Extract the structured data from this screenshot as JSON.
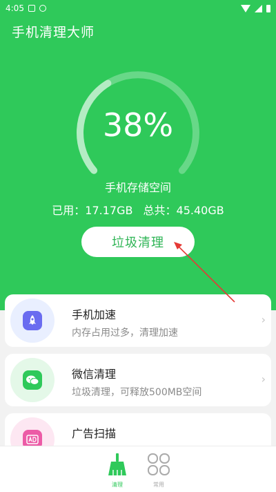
{
  "status_bar": {
    "time": "4:05"
  },
  "app": {
    "title": "手机清理大师"
  },
  "storage": {
    "percent": "38%",
    "percent_value": 0.38,
    "label": "手机存储空间",
    "used": "已用：17.17GB",
    "total": "总共：45.40GB"
  },
  "clean_button": {
    "label": "垃圾清理"
  },
  "features": [
    {
      "title": "手机加速",
      "desc": "内存占用过多，清理加速",
      "icon": "rocket-icon"
    },
    {
      "title": "微信清理",
      "desc": "垃圾清理，可释放500MB空间",
      "icon": "wechat-icon"
    },
    {
      "title": "广告扫描",
      "desc": "",
      "icon": "ad-icon"
    }
  ],
  "bottom_nav": {
    "clean_label": "清理",
    "common_label": "常用"
  },
  "colors": {
    "brand_green": "#2fc95a",
    "accent_green": "#2fb556",
    "annotation_red": "#e53935"
  }
}
